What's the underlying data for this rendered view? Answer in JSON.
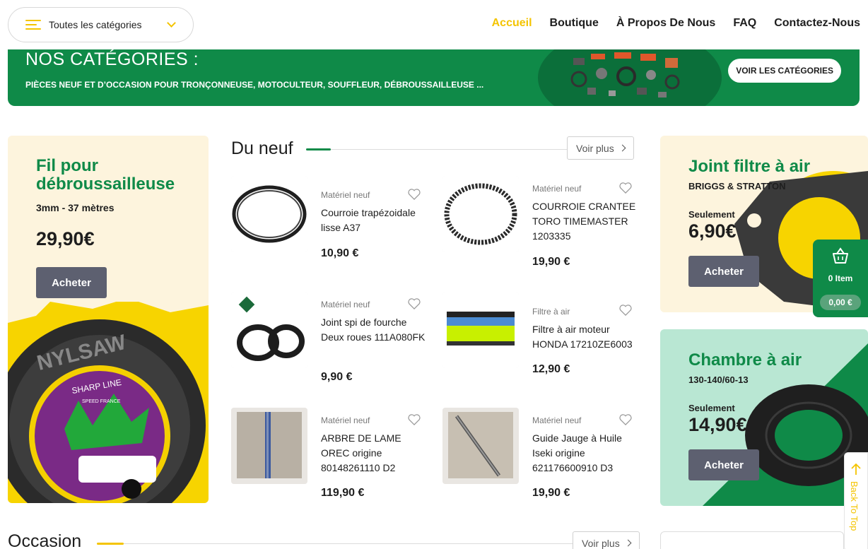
{
  "header": {
    "categories_label": "Toutes les catégories",
    "nav": [
      "Accueil",
      "Boutique",
      "À Propos De Nous",
      "FAQ",
      "Contactez-Nous"
    ]
  },
  "banner": {
    "title": "NOS CATÉGORIES :",
    "subtitle": "PIÈCES NEUF ET D’OCCASION POUR TRONÇONNEUSE, MOTOCULTEUR, SOUFFLEUR, DÉBROUSSAILLEUSE   ...",
    "button": "VOIR LES CATÉGORIES"
  },
  "promo_left": {
    "title": "Fil pour débroussailleuse",
    "subtitle": "3mm - 37 mètres",
    "price": "29,90€",
    "button": "Acheter",
    "image_text": [
      "NYLSAW",
      "SHARP LINE",
      "SPEED FRANCE"
    ]
  },
  "new_section": {
    "title": "Du neuf",
    "more": "Voir plus",
    "products": [
      {
        "category": "Matériel neuf",
        "name": "Courroie trapézoidale lisse A37",
        "price": "10,90 €"
      },
      {
        "category": "Matériel neuf",
        "name": "COURROIE CRANTEE TORO TIMEMASTER 1203335",
        "price": "19,90 €"
      },
      {
        "category": "Matériel neuf",
        "name": "Joint spi de fourche Deux roues 111A080FK",
        "price": "9,90 €"
      },
      {
        "category": "Filtre à air",
        "name": "Filtre à air moteur HONDA 17210ZE6003",
        "price": "12,90 €"
      },
      {
        "category": "Matériel neuf",
        "name": "ARBRE DE LAME OREC origine 80148261110 D2",
        "price": "119,90 €"
      },
      {
        "category": "Matériel neuf",
        "name": "Guide Jauge à Huile Iseki origine 621176600910 D3",
        "price": "19,90 €"
      }
    ]
  },
  "promo_right": [
    {
      "title": "Joint filtre à air",
      "subtitle": "BRIGGS & STRATTON",
      "from": "Seulement",
      "price": "6,90€",
      "button": "Acheter"
    },
    {
      "title": "Chambre à air",
      "subtitle": "130-140/60-13",
      "from": "Seulement",
      "price": "14,90€",
      "button": "Acheter"
    }
  ],
  "cart": {
    "items": "0 Item",
    "total": "0,00 €"
  },
  "back_to_top": "Back To Top",
  "used_section": {
    "title": "Occasion",
    "more": "Voir plus"
  },
  "colors": {
    "green": "#0f8a48",
    "yellow": "#f4c400",
    "cream": "#fdf4dd",
    "mint": "#b9e7d3",
    "button_gray": "#5d6070"
  }
}
